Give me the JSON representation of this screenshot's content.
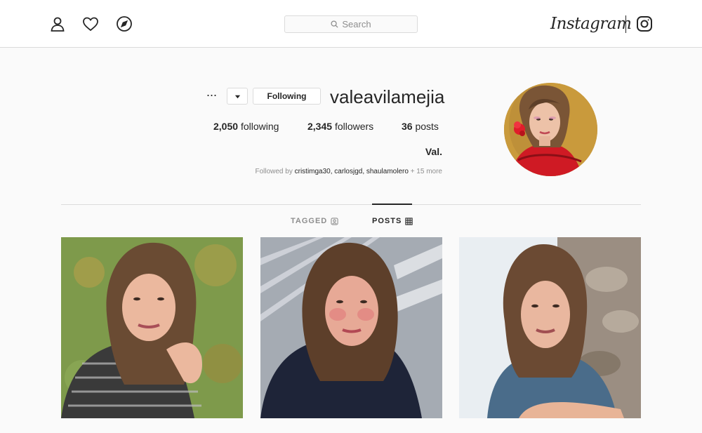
{
  "header": {
    "logo_text": "Instagram",
    "search": {
      "placeholder": "Search",
      "icon": "search-icon"
    },
    "nav_icons": [
      "profile-icon",
      "heart-icon",
      "explore-compass-icon"
    ]
  },
  "profile": {
    "username": "valeavilamejia",
    "following_button_label": "Following",
    "more_label": "···",
    "stats": {
      "posts_count": "36",
      "posts_label": "posts",
      "followers_count": "2,345",
      "followers_label": "followers",
      "following_count": "2,050",
      "following_label": "following"
    },
    "full_name": "Val.",
    "followed_by_prefix": "Followed by",
    "followed_by_names": "cristimga30, carlosjgd, shaulamolero",
    "followed_by_more": "+ 15 more"
  },
  "tabs": [
    {
      "label": "POSTS",
      "icon": "grid-icon",
      "active": true
    },
    {
      "label": "TAGGED",
      "icon": "tag-icon",
      "active": false
    }
  ],
  "posts": [
    {
      "name": "post-1",
      "palette": {
        "bg": "#e9eef2",
        "bg2": "#9b8e82",
        "hair": "#6b4a33",
        "skin": "#e9b79f",
        "top": "#4a6c8a"
      }
    },
    {
      "name": "post-2",
      "palette": {
        "bg": "#c9cdd3",
        "bg2": "#707784",
        "hair": "#5d3f2a",
        "skin": "#e7a996",
        "top": "#1e2438"
      }
    },
    {
      "name": "post-3",
      "palette": {
        "bg": "#7e9a4b",
        "bg2": "#b7a049",
        "hair": "#6a4b33",
        "skin": "#ebb89e",
        "top": "#3a3a3a"
      }
    }
  ],
  "colors": {
    "border": "#dbdbdb",
    "text": "#262626",
    "muted": "#8e8e8e",
    "background": "#fafafa"
  }
}
